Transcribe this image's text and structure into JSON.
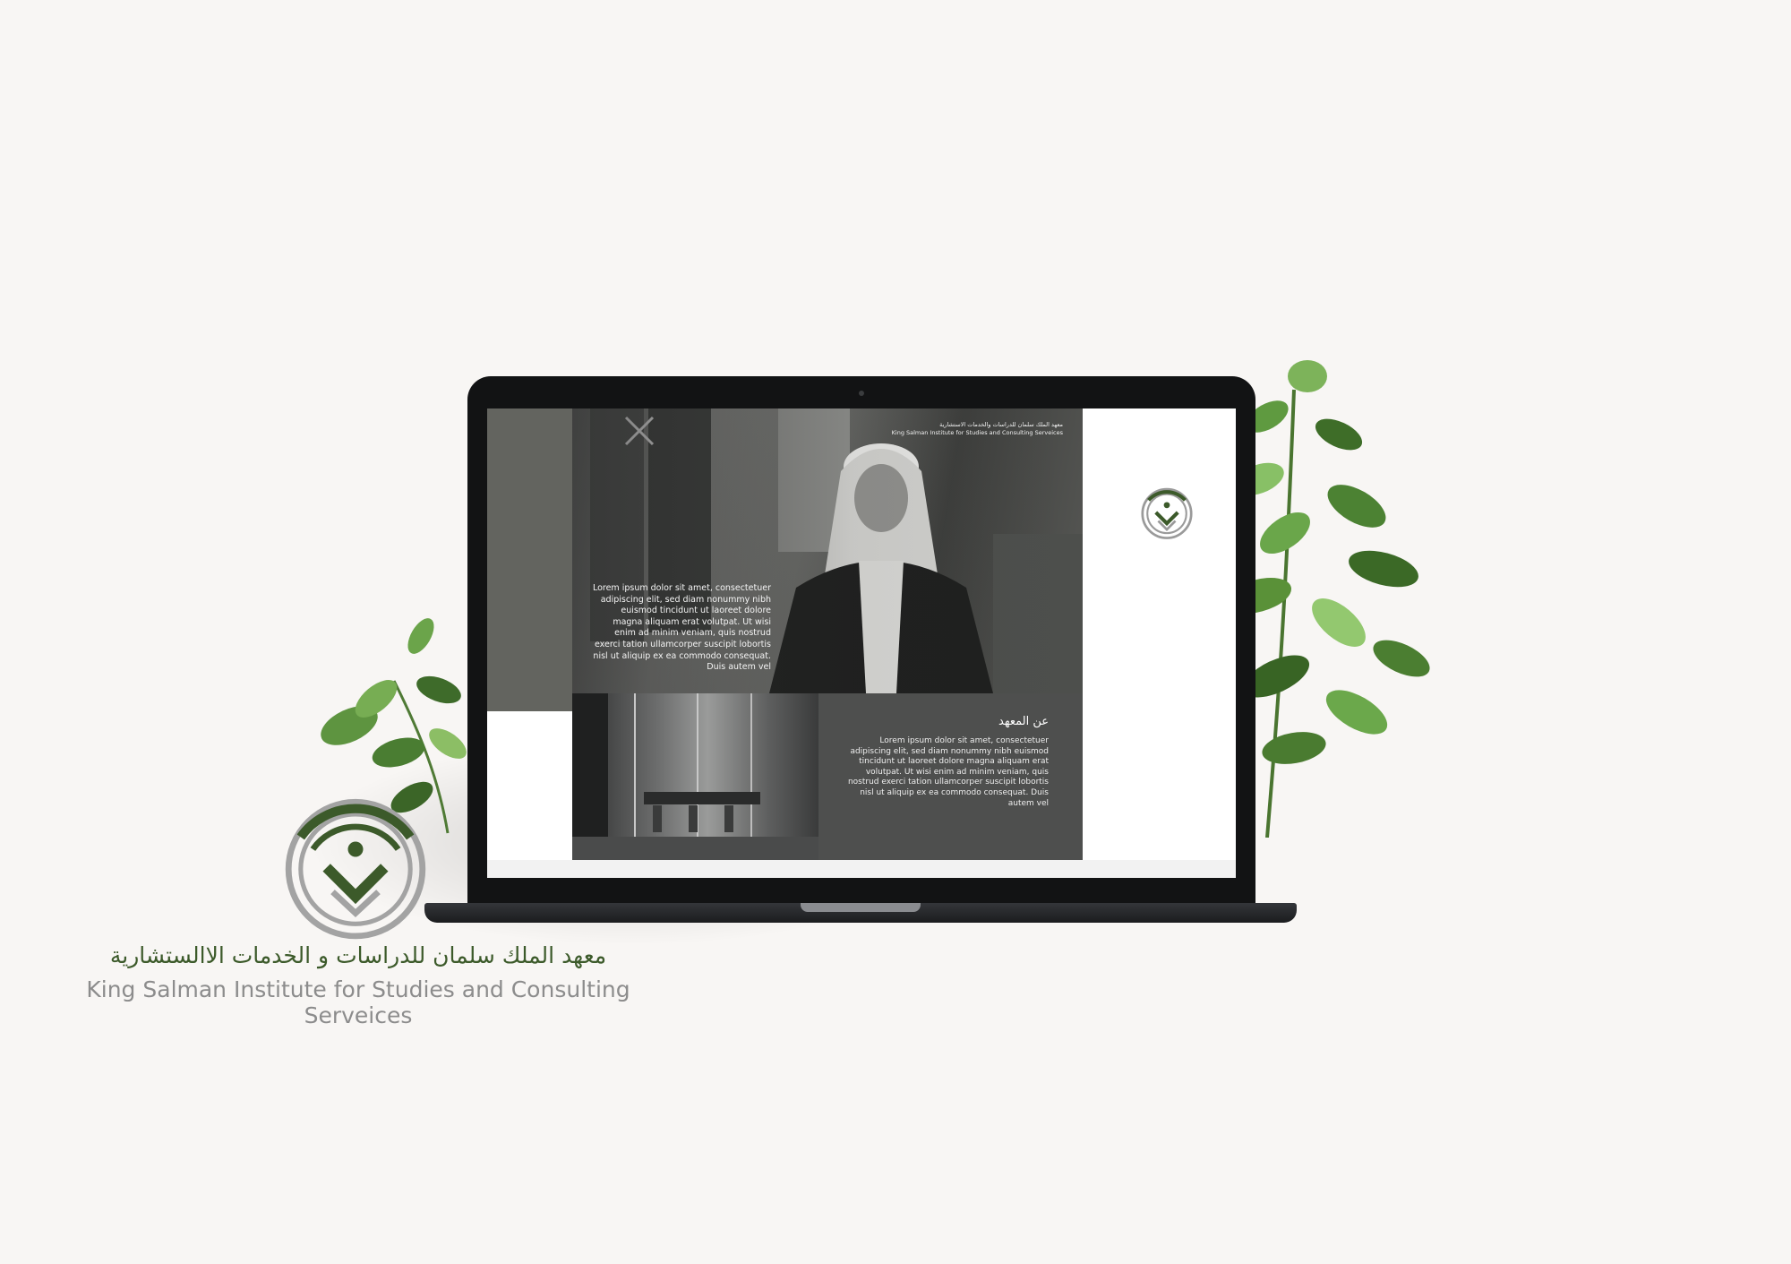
{
  "screen": {
    "header_ar": "معهد الملك سلمان للدراسات والخدمات الاستشارية",
    "header_en": "King Salman Institute for Studies and Consulting Serveices",
    "hero_text": "Lorem ipsum dolor sit amet, consectetuer adipiscing elit, sed diam nonummy nibh euismod tincidunt ut laoreet dolore magna aliquam erat volutpat. Ut wisi enim ad minim veniam, quis nostrud exerci tation ullamcorper suscipit lobortis nisl ut aliquip ex ea commodo consequat. Duis autem vel",
    "about_title": "عن المعهد",
    "about_text": "Lorem ipsum dolor sit amet, consectetuer adipiscing elit, sed diam nonummy nibh euismod tincidunt ut laoreet dolore magna aliquam erat volutpat. Ut wisi enim ad minim veniam, quis nostrud exerci tation ullamcorper suscipit lobortis nisl ut aliquip ex ea commodo consequat. Duis autem vel"
  },
  "brand": {
    "name_ar": "معهد الملك سلمان للدراسات و الخدمات الاالستشارية",
    "name_en": "King Salman Institute for Studies and Consulting Serveices",
    "emblem_icon": "institute-emblem-icon",
    "primary_color": "#3c5a2a",
    "secondary_color": "#8c8c8c"
  }
}
